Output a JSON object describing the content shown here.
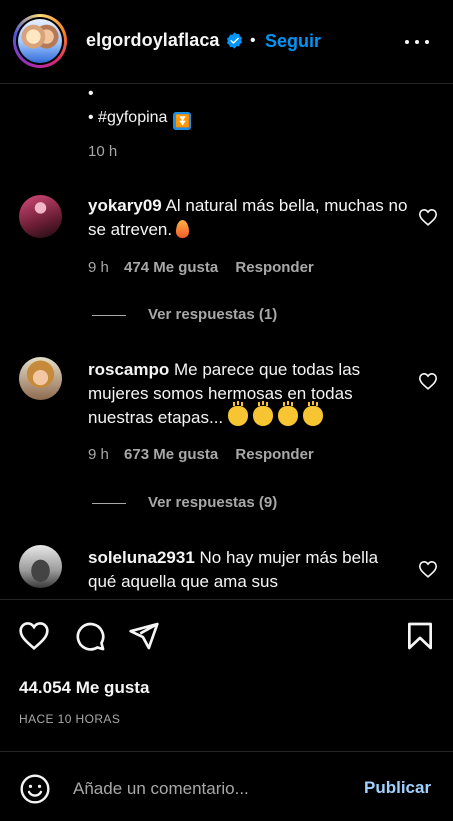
{
  "header": {
    "account": "elgordoylaflaca",
    "separator": "•",
    "follow_label": "Seguir"
  },
  "caption": {
    "bullet_empty": "•",
    "hashtag_line": "• #gyfopina",
    "time": "10 h"
  },
  "comments": [
    {
      "user": "yokary09",
      "text": "Al natural más bella, muchas no se atreven.",
      "time": "9 h",
      "likes": "474 Me gusta",
      "reply_label": "Responder",
      "view_replies": "Ver respuestas (1)"
    },
    {
      "user": "roscampo",
      "text": "Me parece que todas las mujeres somos hermosas en todas nuestras etapas...",
      "time": "9 h",
      "likes": "673 Me gusta",
      "reply_label": "Responder",
      "view_replies": "Ver respuestas (9)"
    },
    {
      "user": "soleluna2931",
      "text": "No hay mujer más bella qué aquella que ama sus"
    }
  ],
  "post": {
    "likes": "44.054 Me gusta",
    "time_ago": "HACE 10 HORAS"
  },
  "comment_box": {
    "placeholder": "Añade un comentario...",
    "publish_label": "Publicar"
  },
  "colors": {
    "accent": "#0095f6",
    "publish": "#a1d2ff",
    "muted": "#a8a8a8",
    "background": "#000000"
  }
}
